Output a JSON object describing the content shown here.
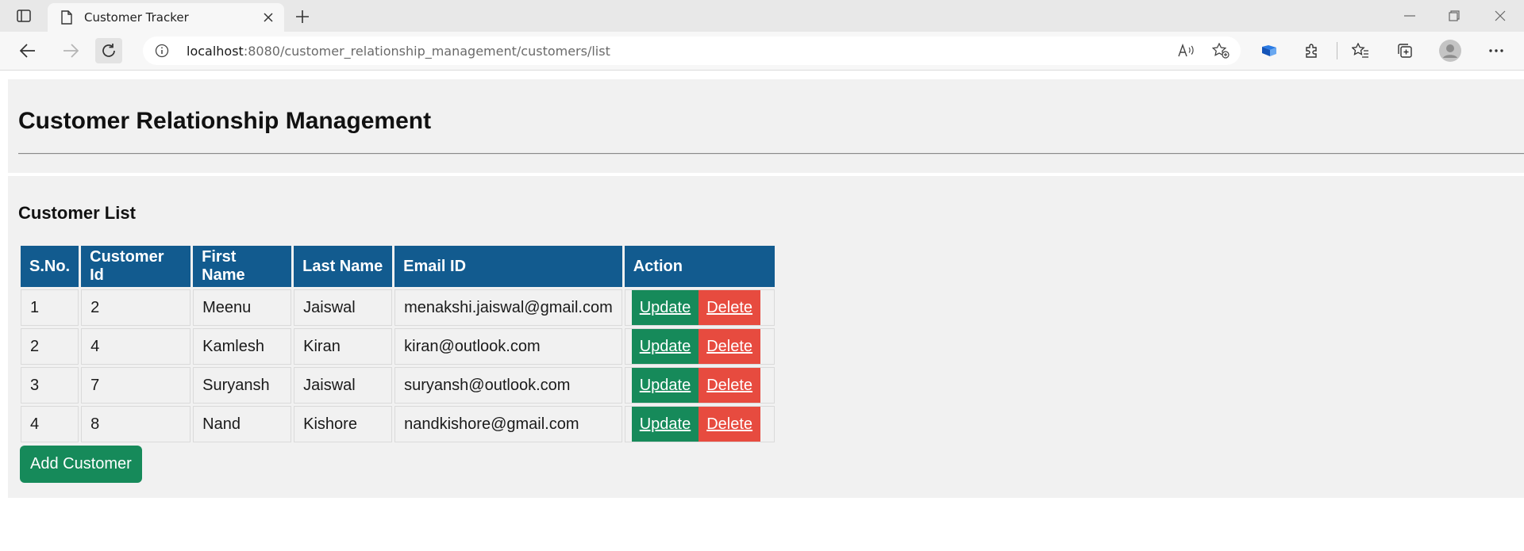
{
  "browser": {
    "tab_title": "Customer Tracker",
    "url_host": "localhost",
    "url_rest": ":8080/customer_relationship_management/customers/list"
  },
  "page": {
    "title": "Customer Relationship Management",
    "list_title": "Customer List",
    "add_button_label": "Add Customer"
  },
  "table": {
    "headers": [
      "S.No.",
      "Customer Id",
      "First Name",
      "Last Name",
      "Email ID",
      "Action"
    ],
    "rows": [
      {
        "sno": "1",
        "id": "2",
        "first": "Meenu",
        "last": "Jaiswal",
        "email": "menakshi.jaiswal@gmail.com"
      },
      {
        "sno": "2",
        "id": "4",
        "first": "Kamlesh",
        "last": "Kiran",
        "email": "kiran@outlook.com"
      },
      {
        "sno": "3",
        "id": "7",
        "first": "Suryansh",
        "last": "Jaiswal",
        "email": "suryansh@outlook.com"
      },
      {
        "sno": "4",
        "id": "8",
        "first": "Nand",
        "last": "Kishore",
        "email": "nandkishore@gmail.com"
      }
    ],
    "update_label": "Update ",
    "delete_label": "Delete"
  },
  "colors": {
    "header_bg": "#125b8f",
    "update_bg": "#168a5a",
    "delete_bg": "#e74b3f",
    "panel_bg": "#f1f1f1"
  }
}
